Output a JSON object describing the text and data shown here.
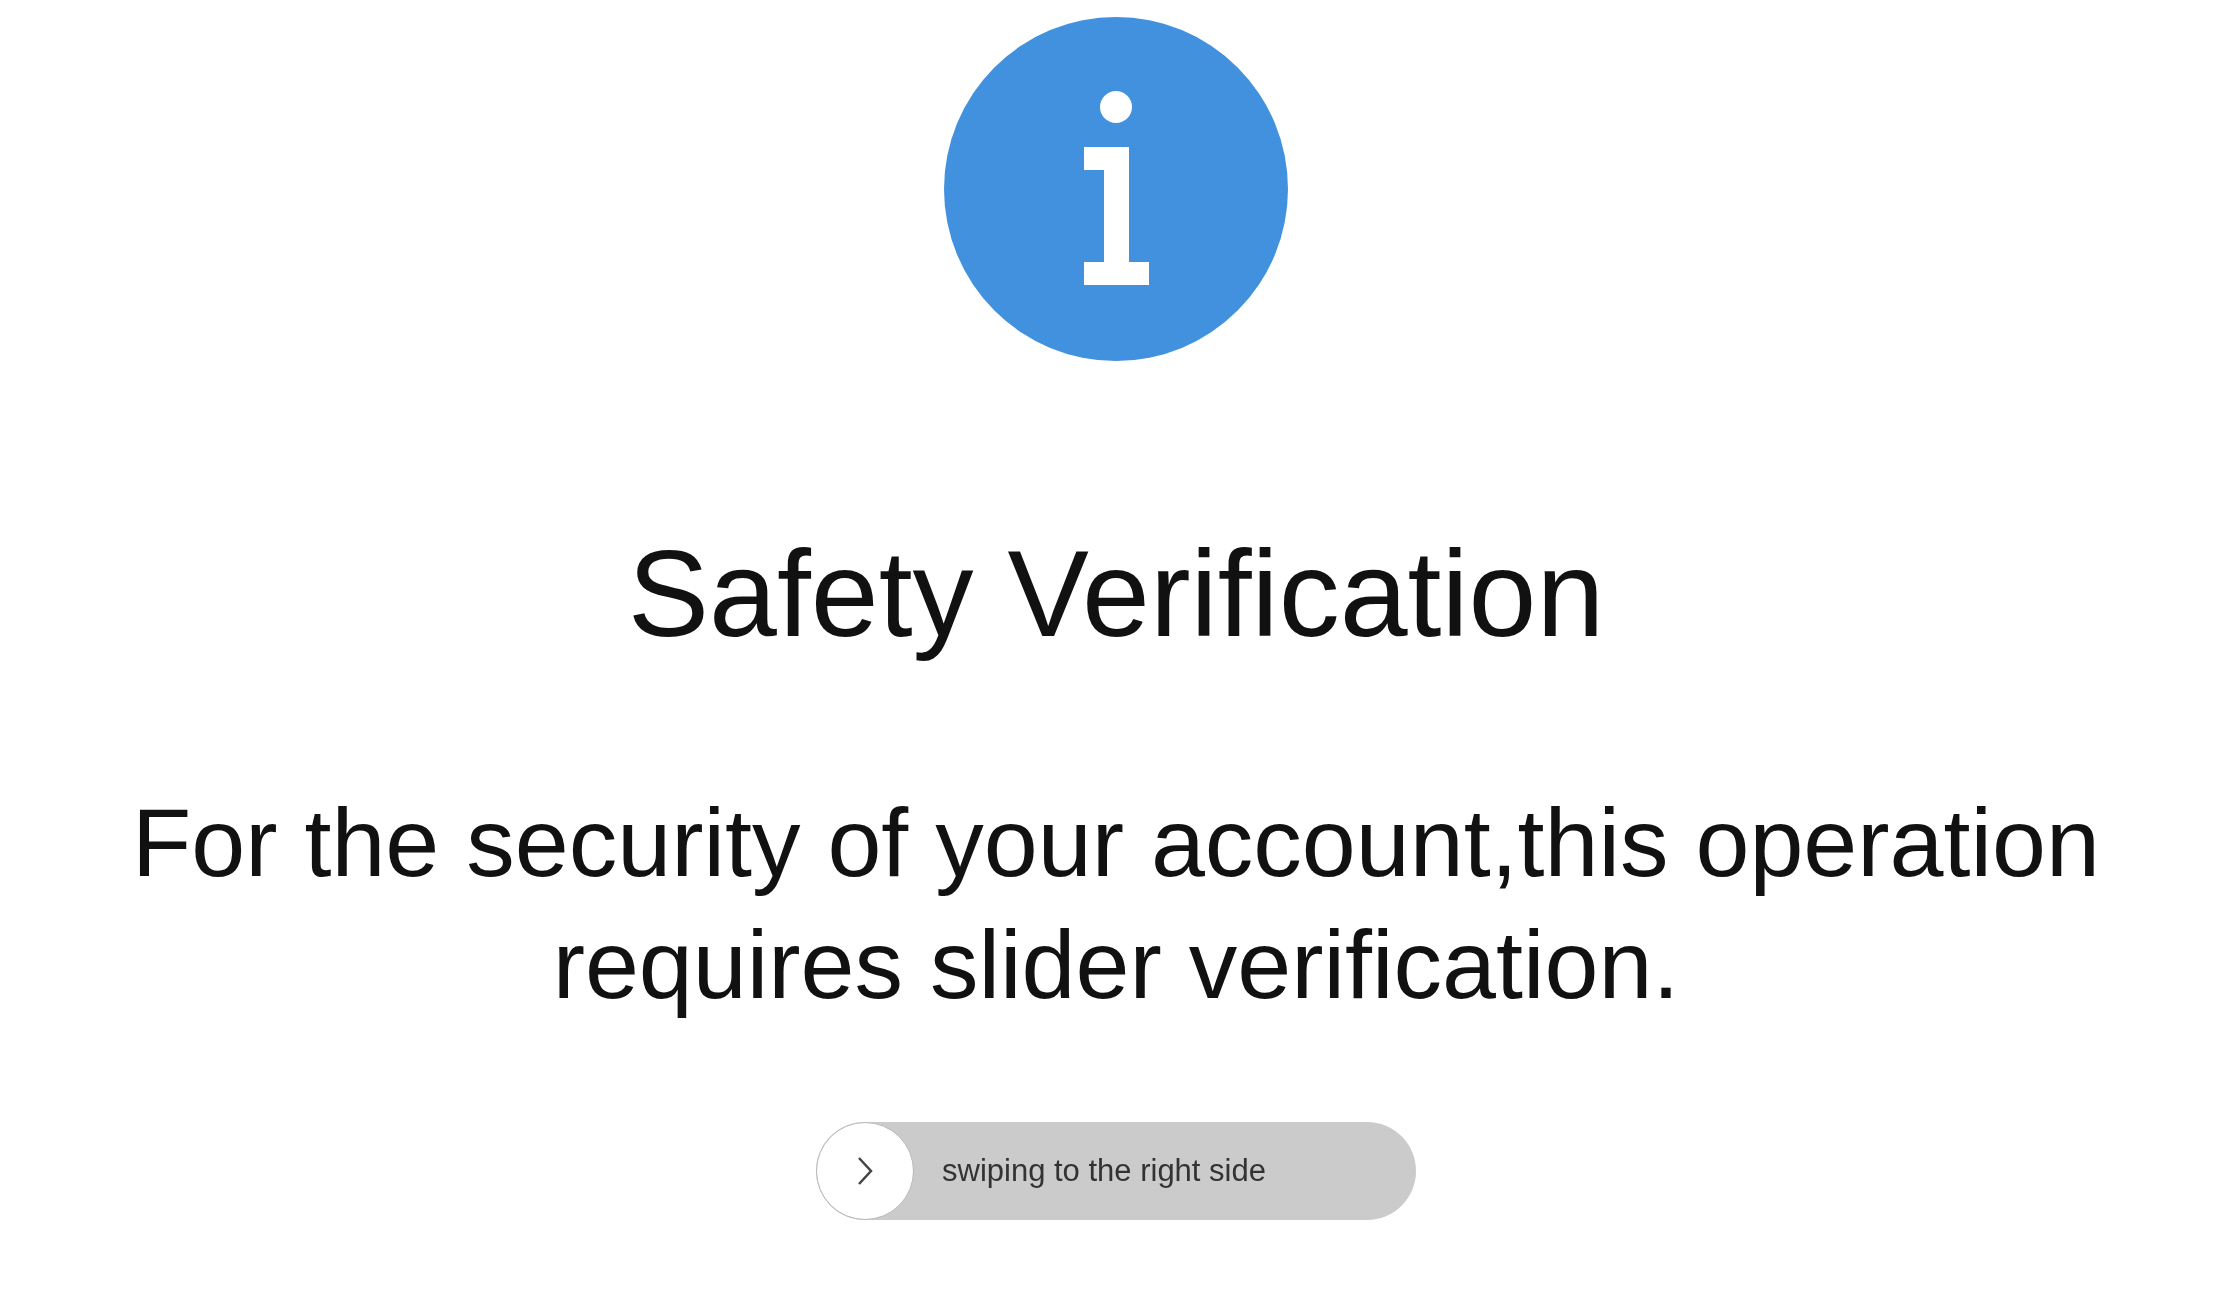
{
  "title": "Safety Verification",
  "message": "For the security of your account,this operation requires slider verification.",
  "slider": {
    "label": "swiping to the right side",
    "level": 0
  }
}
